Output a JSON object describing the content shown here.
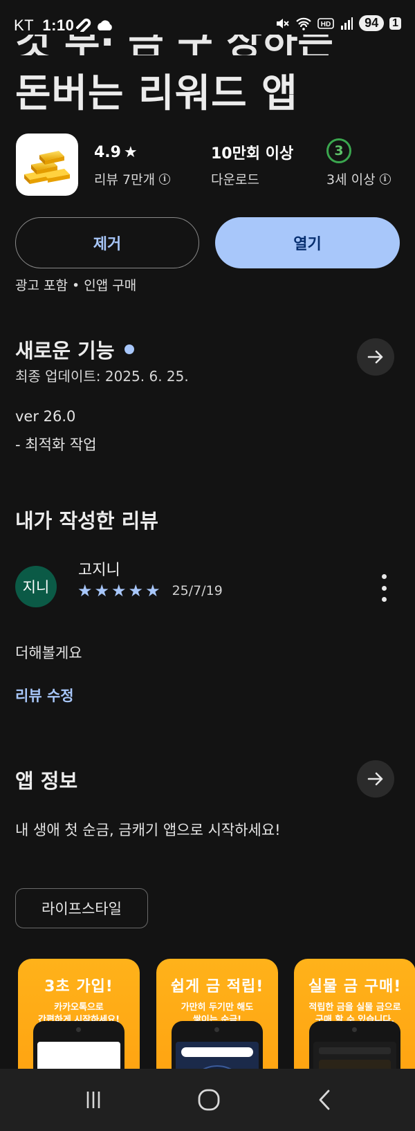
{
  "status_bar": {
    "carrier": "KT",
    "time": "1:10",
    "battery": "94",
    "notification_count": "1"
  },
  "app": {
    "title_partial": "것 부· 금 구 상하는",
    "title": "돈버는 리워드 앱",
    "rating": "4.9",
    "reviews_label": "리뷰 7만개",
    "downloads": "10만회 이상",
    "downloads_label": "다운로드",
    "age_rating": "3",
    "age_label": "3세 이상",
    "remove_label": "제거",
    "open_label": "열기",
    "ads_note": "광고 포함 • 인앱 구매"
  },
  "whats_new": {
    "heading": "새로운 기능",
    "updated": "최종 업데이트: 2025. 6. 25.",
    "version": "ver 26.0",
    "notes": "- 최적화 작업"
  },
  "my_review": {
    "heading": "내가 작성한 리뷰",
    "avatar_text": "지니",
    "author": "고지니",
    "stars": 5,
    "date": "25/7/19",
    "body": "더해볼게요",
    "edit_link": "리뷰 수정"
  },
  "about": {
    "heading": "앱 정보",
    "description": "내 생애 첫 순금, 금캐기 앱으로 시작하세요!",
    "category": "라이프스타일"
  },
  "screenshots": [
    {
      "headline": "3초 가입!",
      "desc1": "카카오톡으로",
      "desc2": "간편하게 시작하세요!"
    },
    {
      "headline": "쉽게 금 적립!",
      "desc1": "가만히 두기만 해도",
      "desc2": "쌓이는 순금!"
    },
    {
      "headline": "실물 금 구매!",
      "desc1": "적립한 금을 실물 금으로",
      "desc2": "구매 할 수 있습니다."
    }
  ],
  "colors": {
    "background": "#131313",
    "accent": "#a8c7fa",
    "open_button_text": "#062e6f",
    "age_badge": "#3aa64e",
    "avatar": "#0b5a46",
    "screenshot_bg": "#ffa914"
  },
  "icons": [
    "gold-bars-icon",
    "star-icon",
    "info-icon",
    "arrow-right-icon",
    "more-vert-icon",
    "recents-icon",
    "home-icon",
    "back-icon"
  ]
}
